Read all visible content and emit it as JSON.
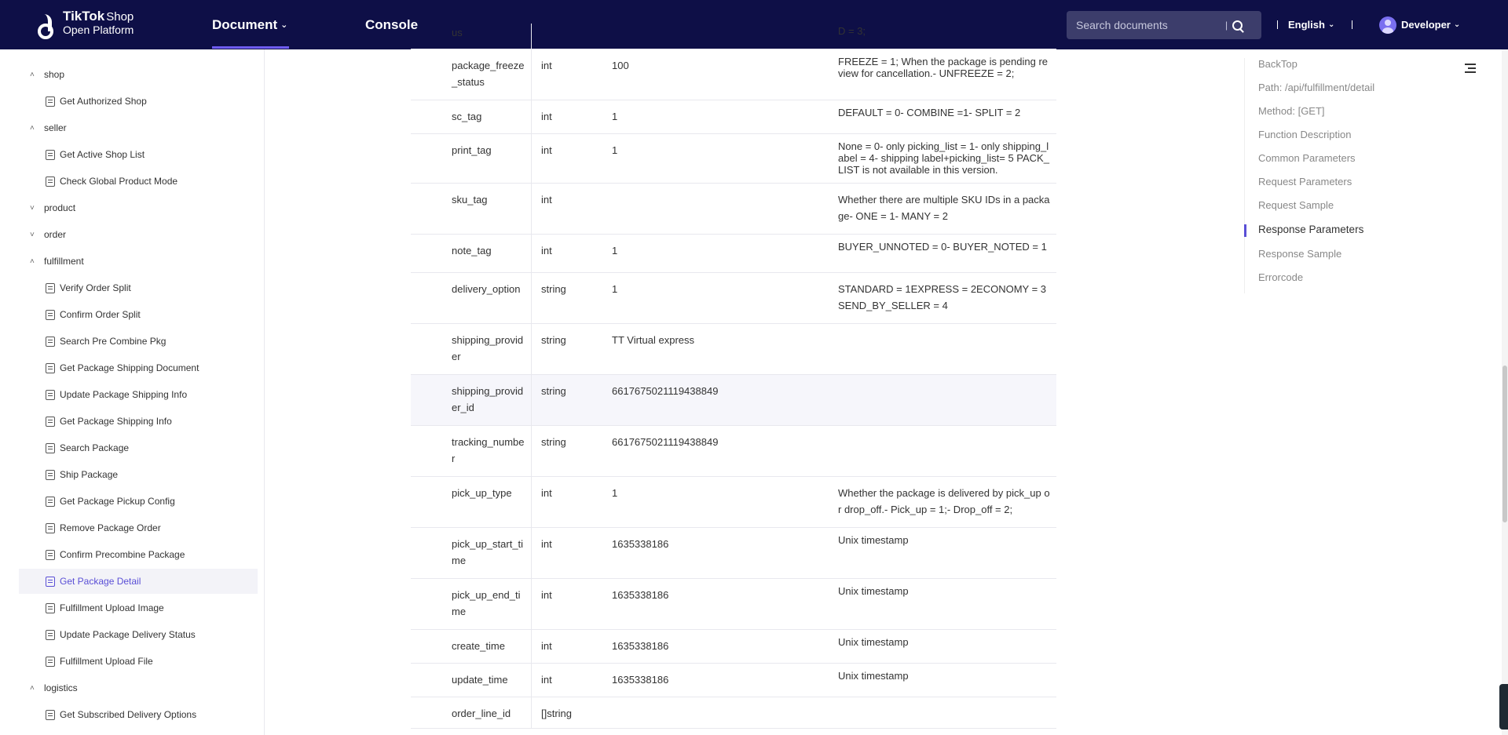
{
  "header": {
    "logo_title": "TikTok",
    "logo_shop": "Shop",
    "logo_subtitle": "Open Platform",
    "nav_document": "Document",
    "nav_console": "Console",
    "search_placeholder": "Search documents",
    "language": "English",
    "user": "Developer"
  },
  "sidebar": {
    "items": [
      {
        "type": "category",
        "label": "shop",
        "expanded": true
      },
      {
        "type": "leaf",
        "label": "Get Authorized Shop"
      },
      {
        "type": "category",
        "label": "seller",
        "expanded": true
      },
      {
        "type": "leaf",
        "label": "Get Active Shop List"
      },
      {
        "type": "leaf",
        "label": "Check Global Product Mode"
      },
      {
        "type": "category",
        "label": "product",
        "expanded": false
      },
      {
        "type": "category",
        "label": "order",
        "expanded": false
      },
      {
        "type": "category",
        "label": "fulfillment",
        "expanded": true
      },
      {
        "type": "leaf",
        "label": "Verify Order Split"
      },
      {
        "type": "leaf",
        "label": "Confirm Order Split"
      },
      {
        "type": "leaf",
        "label": "Search Pre Combine Pkg"
      },
      {
        "type": "leaf",
        "label": "Get Package Shipping Document"
      },
      {
        "type": "leaf",
        "label": "Update Package Shipping Info"
      },
      {
        "type": "leaf",
        "label": "Get Package Shipping Info"
      },
      {
        "type": "leaf",
        "label": "Search Package"
      },
      {
        "type": "leaf",
        "label": "Ship Package"
      },
      {
        "type": "leaf",
        "label": "Get Package Pickup Config"
      },
      {
        "type": "leaf",
        "label": "Remove Package Order"
      },
      {
        "type": "leaf",
        "label": "Confirm Precombine Package"
      },
      {
        "type": "leaf",
        "label": "Get Package Detail",
        "active": true
      },
      {
        "type": "leaf",
        "label": "Fulfillment Upload Image"
      },
      {
        "type": "leaf",
        "label": "Update Package Delivery Status"
      },
      {
        "type": "leaf",
        "label": "Fulfillment Upload File"
      },
      {
        "type": "category",
        "label": "logistics",
        "expanded": true
      },
      {
        "type": "leaf",
        "label": "Get Subscribed Delivery Options"
      }
    ]
  },
  "table": {
    "rows": [
      {
        "name": "us",
        "type": "",
        "sample": "",
        "desc": "D = 3;"
      },
      {
        "name": "package_freeze_status",
        "type": "int",
        "sample": "100",
        "desc": "FREEZE = 1; When the package is pending review for cancellation.- UNFREEZE = 2;"
      },
      {
        "name": "sc_tag",
        "type": "int",
        "sample": "1",
        "desc": "DEFAULT = 0- COMBINE =1- SPLIT = 2"
      },
      {
        "name": "print_tag",
        "type": "int",
        "sample": "1",
        "desc": "None = 0- only picking_list = 1- only shipping_label = 4- shipping label+picking_list= 5 PACK_LIST is not available in this version."
      },
      {
        "name": "sku_tag",
        "type": "int",
        "sample": "",
        "desc": "Whether there are multiple SKU IDs in a package- ONE = 1- MANY = 2"
      },
      {
        "name": "note_tag",
        "type": "int",
        "sample": "1",
        "desc": "BUYER_UNNOTED = 0- BUYER_NOTED = 1"
      },
      {
        "name": "delivery_option",
        "type": "string",
        "sample": "1",
        "desc": "STANDARD = 1EXPRESS = 2ECONOMY = 3 SEND_BY_SELLER = 4"
      },
      {
        "name": "shipping_provider",
        "type": "string",
        "sample": "TT Virtual express",
        "desc": ""
      },
      {
        "name": "shipping_provider_id",
        "type": "string",
        "sample": "6617675021119438849",
        "desc": ""
      },
      {
        "name": "tracking_number",
        "type": "string",
        "sample": "6617675021119438849",
        "desc": ""
      },
      {
        "name": "pick_up_type",
        "type": "int",
        "sample": "1",
        "desc": "Whether the package is delivered by pick_up or drop_off.- Pick_up = 1;- Drop_off = 2;"
      },
      {
        "name": "pick_up_start_time",
        "type": "int",
        "sample": "1635338186",
        "desc": "Unix timestamp"
      },
      {
        "name": "pick_up_end_time",
        "type": "int",
        "sample": "1635338186",
        "desc": "Unix timestamp"
      },
      {
        "name": "create_time",
        "type": "int",
        "sample": "1635338186",
        "desc": "Unix timestamp"
      },
      {
        "name": "update_time",
        "type": "int",
        "sample": "1635338186",
        "desc": "Unix timestamp"
      },
      {
        "name": "order_line_id",
        "type": "[]string",
        "sample": "",
        "desc": ""
      }
    ]
  },
  "toc": {
    "items": [
      {
        "label": "BackTop"
      },
      {
        "label": "Path: /api/fulfillment/detail"
      },
      {
        "label": "Method: [GET]"
      },
      {
        "label": "Function Description"
      },
      {
        "label": "Common Parameters"
      },
      {
        "label": "Request Parameters"
      },
      {
        "label": "Request Sample"
      },
      {
        "label": "Response Parameters",
        "active": true
      },
      {
        "label": "Response Sample"
      },
      {
        "label": "Errorcode"
      }
    ]
  },
  "colors": {
    "topbar": "#0e0f47",
    "accent": "#5a4fd6"
  }
}
